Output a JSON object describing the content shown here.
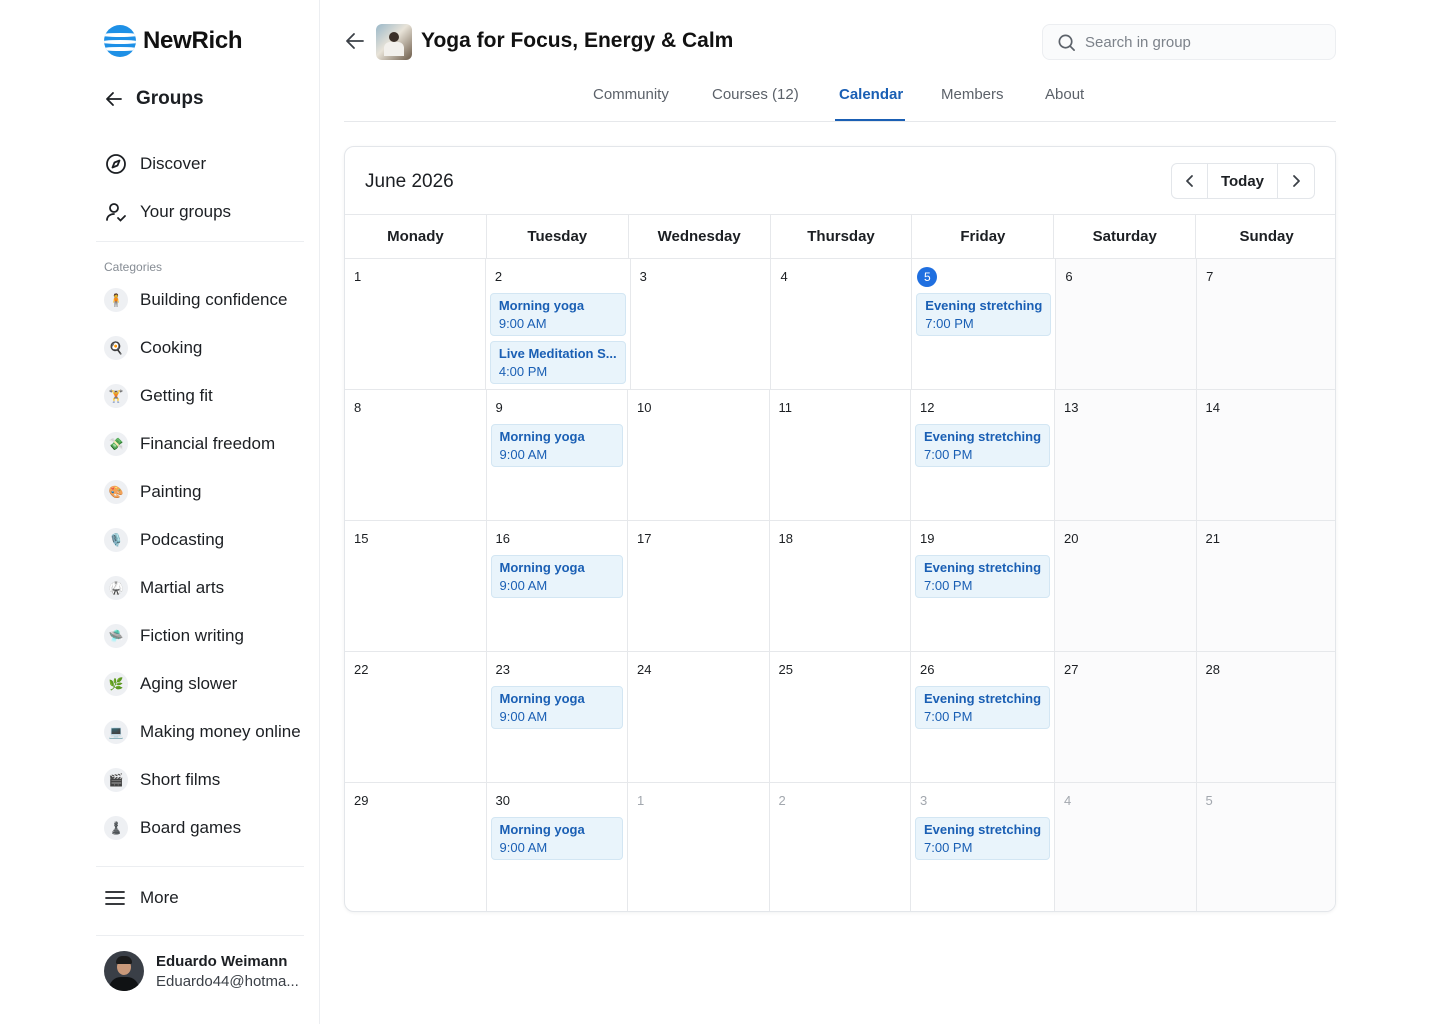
{
  "app": {
    "name": "NewRich"
  },
  "sidebar": {
    "back_label": "Groups",
    "nav": [
      {
        "label": "Discover",
        "icon": "compass-icon"
      },
      {
        "label": "Your groups",
        "icon": "user-check-icon"
      }
    ],
    "categories_heading": "Categories",
    "categories": [
      {
        "label": "Building confidence",
        "emoji": "🧍"
      },
      {
        "label": "Cooking",
        "emoji": "🍳"
      },
      {
        "label": "Getting fit",
        "emoji": "🏋️"
      },
      {
        "label": "Financial freedom",
        "emoji": "💸"
      },
      {
        "label": "Painting",
        "emoji": "🎨"
      },
      {
        "label": "Podcasting",
        "emoji": "🎙️"
      },
      {
        "label": "Martial arts",
        "emoji": "🥋"
      },
      {
        "label": "Fiction writing",
        "emoji": "🛸"
      },
      {
        "label": "Aging slower",
        "emoji": "🌿"
      },
      {
        "label": "Making money online",
        "emoji": "💻"
      },
      {
        "label": "Short films",
        "emoji": "🎬"
      },
      {
        "label": "Board games",
        "emoji": "♟️"
      }
    ],
    "more_label": "More",
    "user": {
      "name": "Eduardo Weimann",
      "email": "Eduardo44@hotma..."
    }
  },
  "header": {
    "title": "Yoga for Focus, Energy & Calm",
    "search_placeholder": "Search in group"
  },
  "tabs": [
    {
      "label": "Community",
      "active": false
    },
    {
      "label": "Courses (12)",
      "active": false
    },
    {
      "label": "Calendar",
      "active": true
    },
    {
      "label": "Members",
      "active": false
    },
    {
      "label": "About",
      "active": false
    }
  ],
  "calendar": {
    "month_label": "June 2026",
    "today_label": "Today",
    "weekdays": [
      "Monady",
      "Tuesday",
      "Wednesday",
      "Thursday",
      "Friday",
      "Saturday",
      "Sunday"
    ],
    "weeks": [
      [
        {
          "num": "1"
        },
        {
          "num": "2",
          "events": [
            {
              "title": "Morning yoga",
              "time": "9:00 AM"
            },
            {
              "title": "Live Meditation S...",
              "time": "4:00 PM"
            }
          ]
        },
        {
          "num": "3"
        },
        {
          "num": "4"
        },
        {
          "num": "5",
          "today": true,
          "events": [
            {
              "title": "Evening stretching",
              "time": "7:00 PM"
            }
          ]
        },
        {
          "num": "6"
        },
        {
          "num": "7"
        }
      ],
      [
        {
          "num": "8"
        },
        {
          "num": "9",
          "events": [
            {
              "title": "Morning yoga",
              "time": "9:00 AM"
            }
          ]
        },
        {
          "num": "10"
        },
        {
          "num": "11"
        },
        {
          "num": "12",
          "events": [
            {
              "title": "Evening stretching",
              "time": "7:00 PM"
            }
          ]
        },
        {
          "num": "13"
        },
        {
          "num": "14"
        }
      ],
      [
        {
          "num": "15"
        },
        {
          "num": "16",
          "events": [
            {
              "title": "Morning yoga",
              "time": "9:00 AM"
            }
          ]
        },
        {
          "num": "17"
        },
        {
          "num": "18"
        },
        {
          "num": "19",
          "events": [
            {
              "title": "Evening stretching",
              "time": "7:00 PM"
            }
          ]
        },
        {
          "num": "20"
        },
        {
          "num": "21"
        }
      ],
      [
        {
          "num": "22"
        },
        {
          "num": "23",
          "events": [
            {
              "title": "Morning yoga",
              "time": "9:00 AM"
            }
          ]
        },
        {
          "num": "24"
        },
        {
          "num": "25"
        },
        {
          "num": "26",
          "events": [
            {
              "title": "Evening stretching",
              "time": "7:00 PM"
            }
          ]
        },
        {
          "num": "27"
        },
        {
          "num": "28"
        }
      ],
      [
        {
          "num": "29"
        },
        {
          "num": "30",
          "events": [
            {
              "title": "Morning yoga",
              "time": "9:00 AM"
            }
          ]
        },
        {
          "num": "1",
          "other": true
        },
        {
          "num": "2",
          "other": true
        },
        {
          "num": "3",
          "other": true,
          "events": [
            {
              "title": "Evening stretching",
              "time": "7:00 PM"
            }
          ]
        },
        {
          "num": "4",
          "other": true
        },
        {
          "num": "5",
          "other": true
        }
      ]
    ]
  },
  "colors": {
    "accent": "#1a5fb4",
    "today_badge": "#1f6fe0",
    "event_bg": "#e9f4fb",
    "logo": "#1e90e6"
  }
}
